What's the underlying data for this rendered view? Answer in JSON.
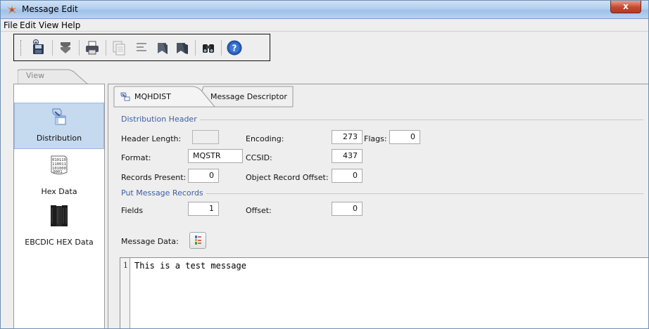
{
  "window": {
    "title": "Message Edit",
    "close_glyph": "x"
  },
  "menu": [
    "File",
    "Edit",
    "View",
    "Help"
  ],
  "toolbar": {
    "buttons": [
      "save-icon",
      "move-down-icon",
      "print-icon",
      "copy-icon",
      "align-icon",
      "bookmark-icon",
      "bookmark-dark-icon",
      "find-icon",
      "help-icon"
    ]
  },
  "left": {
    "tab_label": "View",
    "items": [
      {
        "label": "Distribution",
        "icon": "distribution-icon",
        "selected": true
      },
      {
        "label": "Hex Data",
        "icon": "hex-data-icon",
        "selected": false
      },
      {
        "label": "EBCDIC HEX Data",
        "icon": "ebcdic-hex-data-icon",
        "selected": false
      }
    ]
  },
  "tabs": [
    {
      "label": "MQHDIST",
      "active": true
    },
    {
      "label": "Message Descriptor",
      "active": false
    }
  ],
  "distribution_header": {
    "title": "Distribution Header",
    "header_length_label": "Header Length:",
    "header_length_value": "",
    "encoding_label": "Encoding:",
    "encoding_value": "273",
    "flags_label": "Flags:",
    "flags_value": "0",
    "format_label": "Format:",
    "format_value": "MQSTR",
    "ccsid_label": "CCSID:",
    "ccsid_value": "437",
    "records_present_label": "Records Present:",
    "records_present_value": "0",
    "object_record_offset_label": "Object Record Offset:",
    "object_record_offset_value": "0"
  },
  "put_message_records": {
    "title": "Put Message Records",
    "fields_label": "Fields",
    "fields_value": "1",
    "offset_label": "Offset:",
    "offset_value": "0"
  },
  "message_data": {
    "label": "Message Data:",
    "line_number": "1",
    "text": "This is a test message"
  },
  "colors": {
    "accent": "#3b5fa3",
    "selected_bg": "#c5d9ef",
    "titlebar": "#b3cfee",
    "close_red": "#c4482f"
  }
}
